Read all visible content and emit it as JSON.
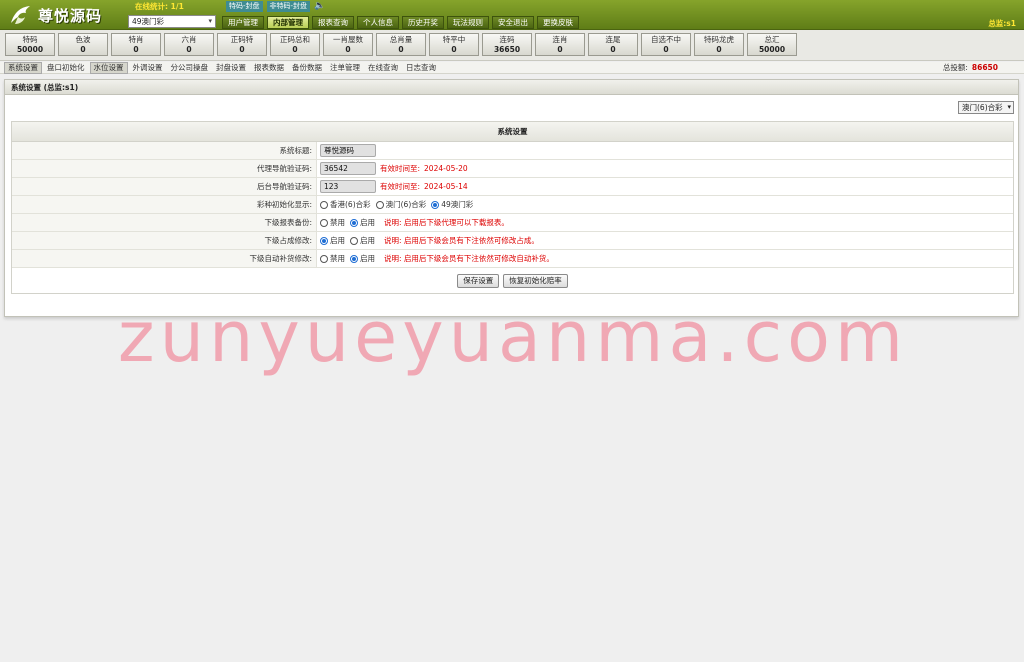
{
  "header": {
    "logo_text": "尊悦源码",
    "online_label": "在线统计: 1/1",
    "game_select": "49澳门彩",
    "seal_tags": [
      "特码-封盘",
      "非特码-封盘"
    ],
    "nav": [
      {
        "label": "用户管理",
        "active": false
      },
      {
        "label": "内部管理",
        "active": true
      },
      {
        "label": "报表查询",
        "active": false
      },
      {
        "label": "个人信息",
        "active": false
      },
      {
        "label": "历史开奖",
        "active": false
      },
      {
        "label": "玩法规则",
        "active": false
      },
      {
        "label": "安全退出",
        "active": false
      },
      {
        "label": "更换皮肤",
        "active": false
      }
    ],
    "account": "总监:s1"
  },
  "quotas": [
    {
      "label": "特码",
      "value": "50000"
    },
    {
      "label": "色波",
      "value": "0"
    },
    {
      "label": "特肖",
      "value": "0"
    },
    {
      "label": "六肖",
      "value": "0"
    },
    {
      "label": "正码特",
      "value": "0"
    },
    {
      "label": "正码总和",
      "value": "0"
    },
    {
      "label": "一肖屋数",
      "value": "0"
    },
    {
      "label": "总肖量",
      "value": "0"
    },
    {
      "label": "特平中",
      "value": "0"
    },
    {
      "label": "连码",
      "value": "36650"
    },
    {
      "label": "连肖",
      "value": "0"
    },
    {
      "label": "连尾",
      "value": "0"
    },
    {
      "label": "自选不中",
      "value": "0"
    },
    {
      "label": "特码龙虎",
      "value": "0"
    },
    {
      "label": "总汇",
      "value": "50000"
    }
  ],
  "sub_nav": {
    "items": [
      {
        "label": "系统设置",
        "active": true
      },
      {
        "label": "盘口初始化",
        "active": false
      },
      {
        "label": "水位设置",
        "active": true
      },
      {
        "label": "外调设置",
        "active": false
      },
      {
        "label": "分公司操盘",
        "active": false
      },
      {
        "label": "封盘设置",
        "active": false
      },
      {
        "label": "报表数据",
        "active": false
      },
      {
        "label": "备份数据",
        "active": false
      },
      {
        "label": "注单管理",
        "active": false
      },
      {
        "label": "在线查询",
        "active": false
      },
      {
        "label": "日志查询",
        "active": false
      }
    ],
    "total_label": "总投额:",
    "total_value": "86650"
  },
  "panel": {
    "title": "系统设置 (总监:s1)",
    "region_select": "澳门(6)合彩",
    "form_title": "系统设置",
    "rows": {
      "system_title": {
        "label": "系统标题:",
        "value": "尊悦源码"
      },
      "agent_code": {
        "label": "代理导航验证码:",
        "value": "36542",
        "note_label": "有效时间至:",
        "note_date": "2024-05-20"
      },
      "admin_code": {
        "label": "后台导航验证码:",
        "value": "123",
        "note_label": "有效时间至:",
        "note_date": "2024-05-14"
      },
      "lottery_init": {
        "label": "彩种初始化显示:",
        "options": [
          "香港(6)合彩",
          "澳门(6)合彩",
          "49澳门彩"
        ],
        "selected": 2
      },
      "report_backup": {
        "label": "下级报表备份:",
        "options": [
          "禁用",
          "启用"
        ],
        "selected": 1,
        "note": "说明: 启用后下级代理可以下载报表。"
      },
      "share_modify": {
        "label": "下级占成修改:",
        "options": [
          "启用",
          "启用"
        ],
        "selected": 0,
        "note": "说明: 启用后下级会员有下注依然可修改占成。"
      },
      "auto_fill": {
        "label": "下级自动补货修改:",
        "options": [
          "禁用",
          "启用"
        ],
        "selected": 1,
        "note": "说明: 启用后下级会员有下注依然可修改自动补货。"
      }
    },
    "save_label": "保存设置",
    "restore_label": "恢复初始化赔率"
  },
  "watermark": "zunyueyuanma.com",
  "colors": {
    "header_green": "#6f8d20",
    "accent_red": "#dd0000",
    "watermark": "#f0788c"
  }
}
